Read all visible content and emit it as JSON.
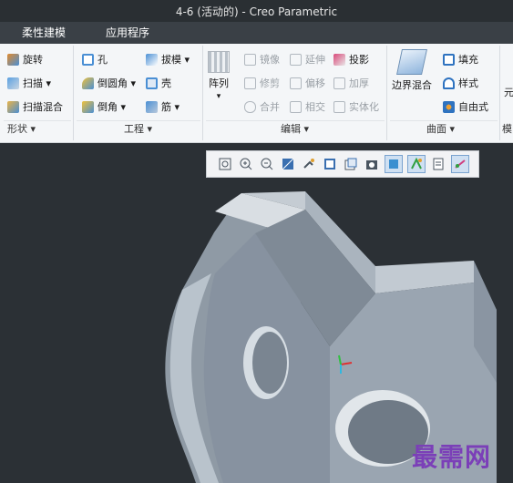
{
  "window": {
    "title": "4-6 (活动的) - Creo Parametric"
  },
  "menu": {
    "tabs": [
      "柔性建模",
      "应用程序"
    ]
  },
  "ribbon": {
    "shape_group": {
      "label": "形状 ▾",
      "items": [
        "旋转",
        "扫描 ▾",
        "扫描混合"
      ]
    },
    "engineering_group": {
      "label": "工程 ▾",
      "items": [
        "孔",
        "倒圆角 ▾",
        "倒角 ▾",
        "拔模 ▾",
        "壳",
        "筋 ▾"
      ]
    },
    "edit_group": {
      "label": "编辑 ▾",
      "pattern_label": "阵列",
      "pattern_arrow": "▾",
      "items": [
        "镜像",
        "延伸",
        "投影",
        "修剪",
        "偏移",
        "加厚",
        "合并",
        "相交",
        "实体化"
      ]
    },
    "surface_group": {
      "label": "曲面 ▾",
      "boundary_blend": "边界混合",
      "items": [
        "填充",
        "样式",
        "自由式"
      ]
    },
    "partial": {
      "label_right": "元",
      "label_bottom": "模"
    }
  },
  "view_toolbar": {
    "icons": [
      "zoom-fit-icon",
      "zoom-in-icon",
      "zoom-out-icon",
      "repaint-icon",
      "spin-center-icon",
      "display-style-icon",
      "saved-orientations-icon",
      "view-manager-icon",
      "datum-display-icon",
      "datum-planes-icon",
      "annotations-icon",
      "spin-axis-icon"
    ]
  },
  "watermark": {
    "text": "最需网"
  },
  "colors": {
    "accent": "#4a8fd4",
    "titlebar": "#2a2f33",
    "ribbon": "#f4f6f8",
    "model": "#9ea9b4"
  }
}
